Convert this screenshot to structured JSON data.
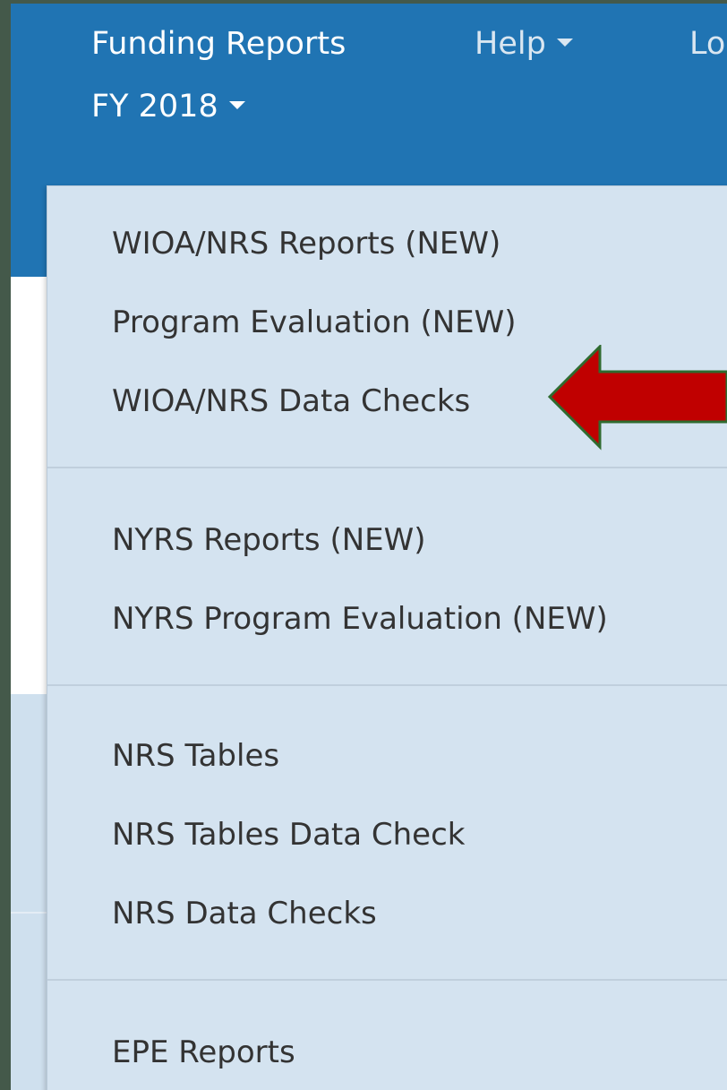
{
  "navbar": {
    "funding_reports": "Funding Reports",
    "help": "Help",
    "truncated_item": "Lo",
    "fiscal_year": "FY 2018"
  },
  "menu": {
    "items": [
      "WIOA/NRS Reports (NEW)",
      "Program Evaluation (NEW)",
      "WIOA/NRS Data Checks",
      "NYRS Reports (NEW)",
      "NYRS Program Evaluation (NEW)",
      "NRS Tables",
      "NRS Tables Data Check",
      "NRS Data Checks",
      "EPE Reports"
    ]
  },
  "annotation": {
    "arrow_icon": "left-arrow-icon",
    "arrow_color": "#c00000",
    "arrow_border": "#2f6b2f"
  },
  "colors": {
    "navbar": "#2074b3",
    "menu_bg": "#d4e3f0",
    "backdrop": "#44594a"
  }
}
